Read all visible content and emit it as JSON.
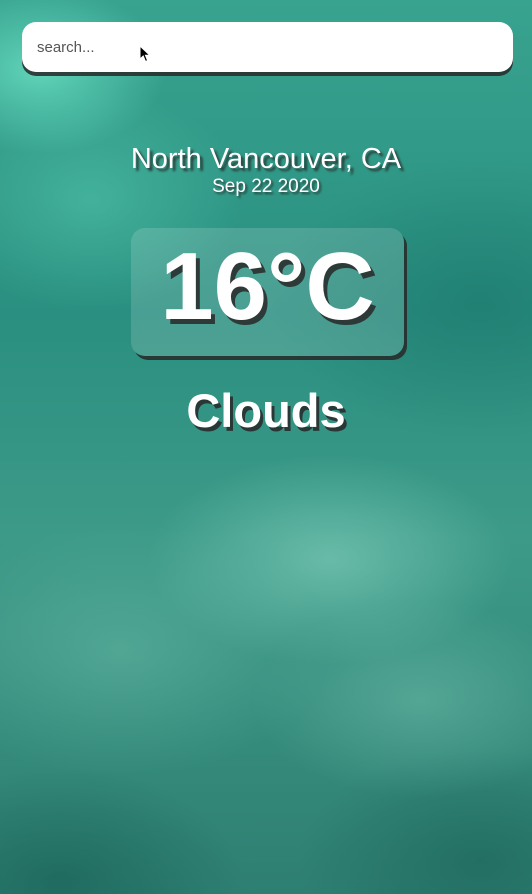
{
  "search": {
    "placeholder": "search...",
    "value": ""
  },
  "location": {
    "city_country": "North Vancouver, CA",
    "date": "Sep 22 2020"
  },
  "weather": {
    "temperature": "16°C",
    "condition": "Clouds"
  },
  "colors": {
    "background": "#2e8f7f",
    "text": "#ffffff",
    "shadow": "#282828"
  },
  "icons": {
    "cursor": "mouse-pointer-icon"
  }
}
